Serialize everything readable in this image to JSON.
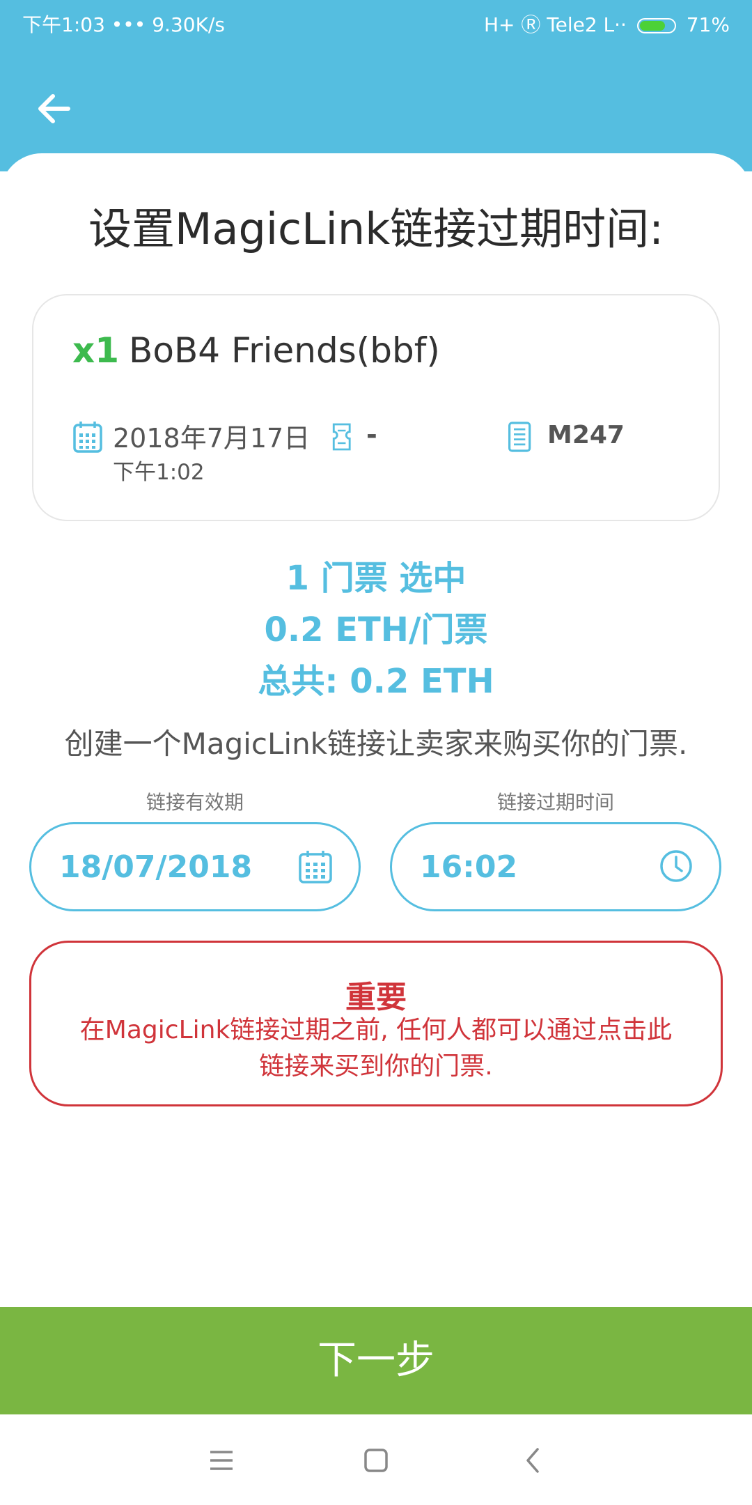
{
  "status_bar": {
    "left": "下午1:03  •••  9.30K/s",
    "right_text": "H+  Ⓡ  Tele2  L··",
    "battery": "71%",
    "battery_level": 0.71
  },
  "header": {
    "back_icon": "arrow-left-icon"
  },
  "title": "设置MagicLink链接过期时间:",
  "ticket": {
    "quantity": "x1",
    "name": "BoB4 Friends(bbf)",
    "date": "2018年7月17日",
    "time": "下午1:02",
    "ticket_value": "-",
    "event_code": "M247",
    "icons": [
      "calendar-icon",
      "ticket-icon",
      "receipt-icon"
    ]
  },
  "summary": {
    "selected": "1 门票 选中",
    "price": "0.2 ETH/门票",
    "total": "总共: 0.2 ETH"
  },
  "description": "创建一个MagicLink链接让卖家来购买你的门票.",
  "expiry": {
    "date_label": "链接有效期",
    "date_value": "18/07/2018",
    "time_label": "链接过期时间",
    "time_value": "16:02"
  },
  "important": {
    "title": "重要",
    "body": "在MagicLink链接过期之前, 任何人都可以通过点击此链接来买到你的门票."
  },
  "next_button": "下一步",
  "nav": {
    "icons": [
      "menu-icon",
      "home-icon",
      "back-icon"
    ]
  },
  "colors": {
    "accent": "#55bee0",
    "green": "#7ab642",
    "qty_green": "#3dba4e",
    "warning_red": "#d0343a"
  }
}
